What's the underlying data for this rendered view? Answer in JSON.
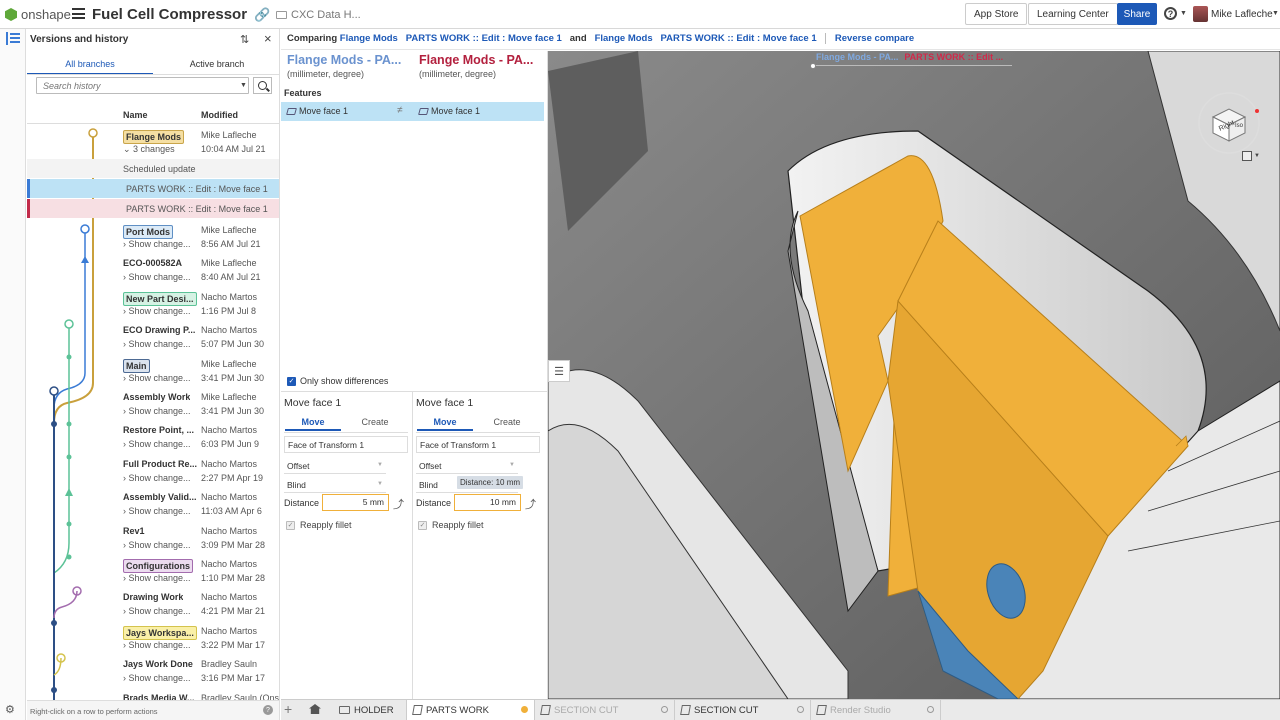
{
  "app": {
    "logo": "onshape",
    "title": "Fuel Cell Compressor",
    "folder": "CXC Data H..."
  },
  "topbar": {
    "app_store": "App Store",
    "learning_center": "Learning Center",
    "share": "Share",
    "help": "?",
    "user": "Mike Lafleche"
  },
  "history": {
    "title": "Versions and history",
    "tabs": {
      "all": "All branches",
      "active": "Active branch"
    },
    "search_placeholder": "Search history",
    "columns": {
      "name": "Name",
      "modified": "Modified"
    },
    "top": {
      "name": "Flange Mods",
      "sub": "3 changes",
      "author": "Mike Lafleche",
      "date": "10:04 AM Jul 21",
      "tag_bg": "#f5dfa3",
      "tag_border": "#c9a54b"
    },
    "scheduled": "Scheduled update",
    "change_a": "PARTS WORK :: Edit : Move face 1",
    "change_b": "PARTS WORK :: Edit : Move face 1",
    "rows": [
      {
        "name": "Port Mods",
        "sub": "Show change...",
        "author": "Mike Lafleche",
        "date": "8:56 AM Jul 21",
        "tag": "#dbeaf7",
        "tag_border": "#5f8fc4"
      },
      {
        "name": "ECO-000582A",
        "sub": "Show change...",
        "author": "Mike Lafleche",
        "date": "8:40 AM Jul 21"
      },
      {
        "name": "New Part Desi...",
        "sub": "Show change...",
        "author": "Nacho Martos",
        "date": "1:16 PM Jul 8",
        "tag": "#d6f2e4",
        "tag_border": "#5cc297"
      },
      {
        "name": "ECO Drawing P...",
        "sub": "Show change...",
        "author": "Nacho Martos",
        "date": "5:07 PM Jun 30"
      },
      {
        "name": "Main",
        "sub": "Show change...",
        "author": "Mike Lafleche",
        "date": "3:41 PM Jun 30",
        "tag": "#dbe3ee",
        "tag_border": "#4d6a93"
      },
      {
        "name": "Assembly Work",
        "sub": "Show change...",
        "author": "Mike Lafleche",
        "date": "3:41 PM Jun 30"
      },
      {
        "name": "Restore Point, ...",
        "sub": "Show change...",
        "author": "Nacho Martos",
        "date": "6:03 PM Jun 9"
      },
      {
        "name": "Full Product Re...",
        "sub": "Show change...",
        "author": "Nacho Martos",
        "date": "2:27 PM Apr 19"
      },
      {
        "name": "Assembly Valid...",
        "sub": "Show change...",
        "author": "Nacho Martos",
        "date": "11:03 AM Apr 6"
      },
      {
        "name": "Rev1",
        "sub": "Show change...",
        "author": "Nacho Martos",
        "date": "3:09 PM Mar 28"
      },
      {
        "name": "Configurations",
        "sub": "Show change...",
        "author": "Nacho Martos",
        "date": "1:10 PM Mar 28",
        "tag": "#ecdcef",
        "tag_border": "#a36cae"
      },
      {
        "name": "Drawing Work",
        "sub": "Show change...",
        "author": "Nacho Martos",
        "date": "4:21 PM Mar 21"
      },
      {
        "name": "Jays Workspa...",
        "sub": "Show change...",
        "author": "Nacho Martos",
        "date": "3:22 PM Mar 17",
        "tag": "#faf0a8",
        "tag_border": "#d4c34d"
      },
      {
        "name": "Jays Work Done",
        "sub": "Show change...",
        "author": "Bradley Sauln",
        "date": "3:16 PM Mar 17"
      },
      {
        "name": "Brads Media W...",
        "sub": "",
        "author": "Bradley Sauln (Ons",
        "date": ""
      }
    ],
    "footer_hint": "Right-click on a row to perform actions"
  },
  "compare": {
    "label": "Comparing",
    "a_branch": "Flange Mods",
    "a_change": "PARTS WORK :: Edit : Move face 1",
    "and": "and",
    "b_branch": "Flange Mods",
    "b_change": "PARTS WORK :: Edit : Move face 1",
    "reverse": "Reverse compare",
    "left_title": "Flange Mods - PA...",
    "right_title": "Flange Mods - PA...",
    "units": "(millimeter, degree)",
    "features_label": "Features",
    "feature_left": "Move face 1",
    "feature_right": "Move face 1",
    "only_diff": "Only show differences",
    "left": {
      "title": "Move face 1",
      "tab_move": "Move",
      "tab_create": "Create",
      "face": "Face of Transform 1",
      "type": "Offset",
      "end": "Blind",
      "distance_label": "Distance",
      "distance": "5 mm",
      "fillet": "Reapply fillet"
    },
    "right": {
      "title": "Move face 1",
      "tab_move": "Move",
      "tab_create": "Create",
      "face": "Face of Transform 1",
      "type": "Offset",
      "end": "Blind",
      "distance_label": "Distance",
      "distance": "10 mm",
      "fillet": "Reapply fillet",
      "tooltip": "Distance: 10 mm"
    }
  },
  "viewport": {
    "strip_left": "Flange Mods - PA...",
    "strip_right": "PARTS WORK :: Edit ...",
    "cube_face_right": "Right",
    "cube_face_back": "Iso"
  },
  "tabs": [
    {
      "label": "HOLDER",
      "state": "normal"
    },
    {
      "label": "PARTS WORK",
      "state": "active"
    },
    {
      "label": "SECTION CUT",
      "state": "dim"
    },
    {
      "label": "SECTION CUT",
      "state": "normal"
    },
    {
      "label": "Render Studio",
      "state": "dim"
    }
  ],
  "colors": {
    "accent": "#1d59b7",
    "part_orange": "#f0b03a",
    "part_blue": "#4a84b8"
  }
}
